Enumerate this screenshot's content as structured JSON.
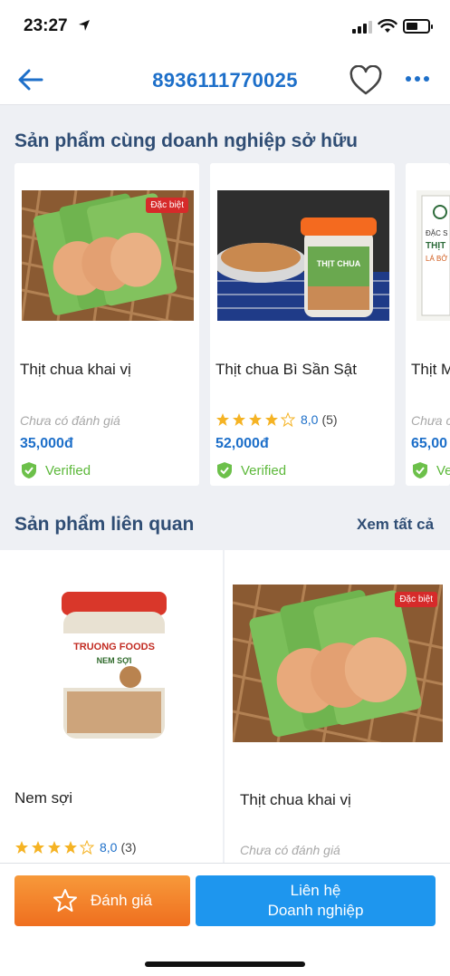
{
  "status_bar": {
    "time": "23:27"
  },
  "header": {
    "title": "8936111770025"
  },
  "section_same_owner": {
    "title": "Sản phẩm cùng doanh nghiệp sở hữu",
    "items": [
      {
        "name": "Thịt chua khai vị",
        "rating_text": "Chưa có đánh giá",
        "price": "35,000đ",
        "verified": "Verified",
        "badge": "Đặc biệt"
      },
      {
        "name": "Thịt chua Bì Sần Sật",
        "stars": 4.5,
        "score": "8,0",
        "count": "(5)",
        "price": "52,000đ",
        "verified": "Verified",
        "jar_label": "THỊT CHUA"
      },
      {
        "name": "Thịt M",
        "rating_text": "Chưa c",
        "price": "65,00",
        "verified": "Ve",
        "box_label_1": "ĐẶC S",
        "box_label_2": "THỊT",
        "box_label_3": "LÁ BỞ"
      }
    ]
  },
  "section_related": {
    "title": "Sản phẩm liên quan",
    "see_all": "Xem tất cả",
    "items": [
      {
        "name": "Nem sợi",
        "stars": 4,
        "score": "8,0",
        "count": "(3)",
        "brand": "TRUONG FOODS",
        "product_label": "NEM SỢI"
      },
      {
        "name": "Thịt chua khai vị",
        "rating_text": "Chưa có đánh giá",
        "badge": "Đặc biệt"
      }
    ]
  },
  "bottom_actions": {
    "rate_label": "Đánh giá",
    "contact_line1": "Liên hệ",
    "contact_line2": "Doanh nghiệp"
  },
  "colors": {
    "accent": "#1d6fc9",
    "verified": "#5cb83a",
    "rate": "#ef6f1f",
    "contact": "#1e96ee"
  }
}
